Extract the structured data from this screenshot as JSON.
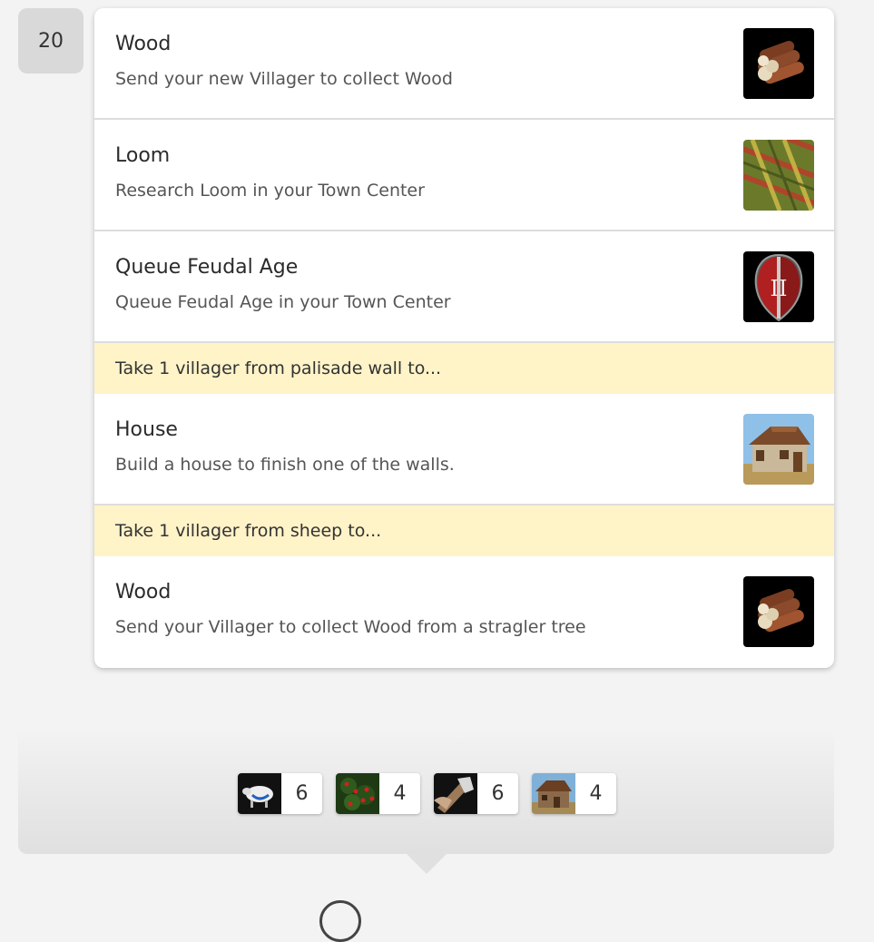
{
  "step": {
    "number": "20"
  },
  "tasks": [
    {
      "type": "task",
      "title": "Wood",
      "description": "Send your new Villager to collect Wood",
      "icon": "wood-icon"
    },
    {
      "type": "task",
      "title": "Loom",
      "description": "Research Loom in your Town Center",
      "icon": "loom-icon"
    },
    {
      "type": "task",
      "title": "Queue Feudal Age",
      "description": "Queue Feudal Age in your Town Center",
      "icon": "feudal-age-icon"
    },
    {
      "type": "notice",
      "text": "Take 1 villager from palisade wall to..."
    },
    {
      "type": "task",
      "title": "House",
      "description": "Build a house to finish one of the walls.",
      "icon": "house-icon"
    },
    {
      "type": "notice",
      "text": "Take 1 villager from sheep to..."
    },
    {
      "type": "task",
      "title": "Wood",
      "description": "Send your Villager to collect Wood from a stragler tree",
      "icon": "wood-icon"
    }
  ],
  "resources": [
    {
      "name": "sheep-icon",
      "count": "6"
    },
    {
      "name": "berries-icon",
      "count": "4"
    },
    {
      "name": "lumber-icon",
      "count": "6"
    },
    {
      "name": "house-builder-icon",
      "count": "4"
    }
  ],
  "colors": {
    "notice_bg": "#fff3c8",
    "card_bg": "#ffffff",
    "page_bg": "#f3f3f3",
    "badge_bg": "#d9d9d9"
  }
}
